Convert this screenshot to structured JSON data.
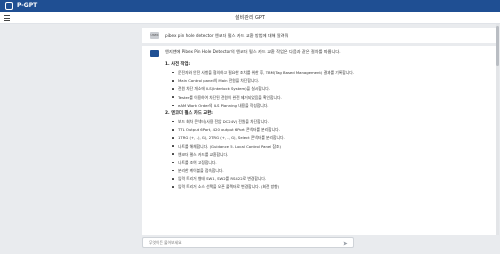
{
  "app": {
    "title": "P-GPT"
  },
  "header": {
    "page_title": "설비관리 GPT"
  },
  "user_message": {
    "avatar_label": "USER",
    "text": "pibex pin hole detector 엔코더 펄스 카드 교환 방법에 대해 알려줘"
  },
  "answer": {
    "intro": "엔지밴에 Pibex Pin Hole Detector의 엔코더 펄스 카드 교환 작업은 다음과 같은 절차를 따릅니다.",
    "sections": [
      {
        "title": "1. 사전 작업:",
        "items": [
          "운전자와 안전 사항을 협의하고 필요한 조치를 위한 후, TBM(Tag Based Management) 결과를 기록합니다.",
          "Main Control panel의 Main 전원을 차단합니다.",
          "전원 차단 개소에 ILS(Interlock System)을 실시합니다.",
          "Tester를 이용하여 차단된 전원이 완전 제거되었음을 확인합니다.",
          "eAM Work Order의 ILS Planning 내용을 작성합니다."
        ]
      },
      {
        "title": "2. 엔코더 펄스 카드 교환:",
        "items": [
          "보드 회차 콘넥터(사용 전압 DC24V) 전원을 차단합니다.",
          "TTL Output 6Port, 420 output 6Port 콘넥터를 분리합니다.",
          "1TRG (+, -), G), 2TRG (+, -, G), Select 콘넥터를 분리합니다.",
          "나트를 해체합니다. (Guidance 5. Local Control Panel 참조)",
          "엔코더 펄스 카드를 교환합니다.",
          "나트를 조여 고정합니다.",
          "분리한 케이블을 접속합니다.",
          "입력 트리거 형태 SW1, SW2를 RS422로 변경합니다.",
          "입력 트리거 소스 선택을 오픈 콜렉터로 변경합니다. (회전 방향)"
        ]
      }
    ]
  },
  "input": {
    "placeholder": "무엇이든 물어보세요"
  }
}
